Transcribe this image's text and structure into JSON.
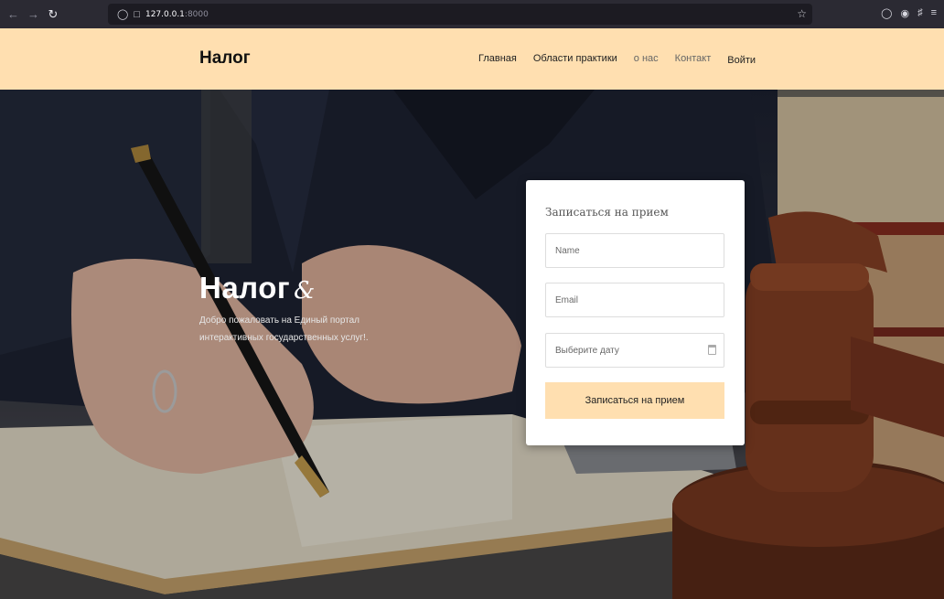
{
  "browser": {
    "url_host": "127.0.0.1",
    "url_port": ":8000"
  },
  "site": {
    "logo": "Налог"
  },
  "nav": {
    "items": [
      {
        "label": "Главная"
      },
      {
        "label": "Области практики"
      },
      {
        "label": "о нас"
      },
      {
        "label": "Контакт"
      },
      {
        "label": "Войти"
      }
    ]
  },
  "hero": {
    "title": "Налог",
    "title_amp": "&",
    "text": "Добро пожаловать на Единый портал интерактивных государственных услуг!."
  },
  "form": {
    "title": "Записаться на прием",
    "name_placeholder": "Name",
    "email_placeholder": "Email",
    "date_placeholder": "Выберите дату",
    "submit_label": "Записаться на прием"
  },
  "colors": {
    "accent": "#ffdfb0",
    "browser_bg": "#2b2a33"
  }
}
